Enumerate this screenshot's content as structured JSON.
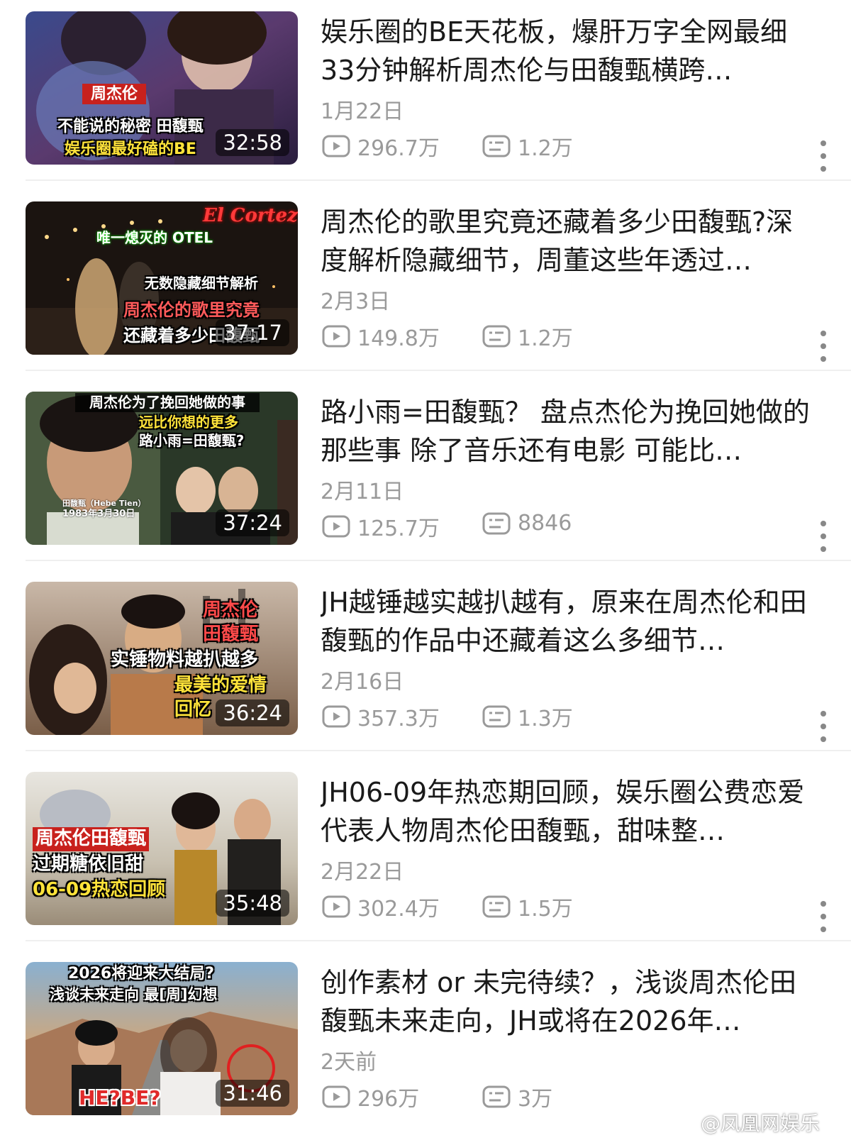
{
  "videos": [
    {
      "title": "娱乐圈的BE天花板，爆肝万字全网最细 33分钟解析周杰伦与田馥甄横跨…",
      "date": "1月22日",
      "views": "296.7万",
      "comments": "1.2万",
      "duration": "32:58",
      "overlay": [
        "周杰伦",
        "不能说的秘密 田馥甄",
        "娱乐圈最好磕的BE"
      ]
    },
    {
      "title": "周杰伦的歌里究竟还藏着多少田馥甄?深度解析隐藏细节，周董这些年透过…",
      "date": "2月3日",
      "views": "149.8万",
      "comments": "1.2万",
      "duration": "37:17",
      "overlay": [
        "El Cortez",
        "唯一熄灭的 OTEL",
        "无数隐藏细节解析",
        "周杰伦的歌里究竟",
        "还藏着多少田馥甄"
      ]
    },
    {
      "title": "路小雨=田馥甄？ 盘点杰伦为挽回她做的那些事 除了音乐还有电影 可能比…",
      "date": "2月11日",
      "views": "125.7万",
      "comments": "8846",
      "duration": "37:24",
      "overlay": [
        "周杰伦为了挽回她做的事",
        "远比你想的更多",
        "路小雨=田馥甄?",
        "田馥甄（Hebe Tien）",
        "1983年3月30日"
      ]
    },
    {
      "title": "JH越锤越实越扒越有，原来在周杰伦和田馥甄的作品中还藏着这么多细节…",
      "date": "2月16日",
      "views": "357.3万",
      "comments": "1.3万",
      "duration": "36:24",
      "overlay": [
        "周杰伦",
        "田馥甄",
        "实锤物料越扒越多",
        "最美的爱情",
        "回忆"
      ]
    },
    {
      "title": "JH06-09年热恋期回顾，娱乐圈公费恋爱代表人物周杰伦田馥甄，甜味整…",
      "date": "2月22日",
      "views": "302.4万",
      "comments": "1.5万",
      "duration": "35:48",
      "overlay": [
        "周杰伦田馥甄",
        "过期糖依旧甜",
        "06-09热恋回顾"
      ]
    },
    {
      "title": "创作素材 or 未完待续？，浅谈周杰伦田馥甄未来走向，JH或将在2026年…",
      "date": "2天前",
      "views": "296万",
      "comments": "3万",
      "duration": "31:46",
      "overlay": [
        "2026将迎来大结局?",
        "浅谈未来走向 最[周]幻想",
        "HE?BE?"
      ]
    }
  ],
  "watermark": "@凤凰网娱乐",
  "colors": {
    "meta_gray": "#9a9a9a",
    "title": "#1a1a1a",
    "divider": "#efefef"
  }
}
